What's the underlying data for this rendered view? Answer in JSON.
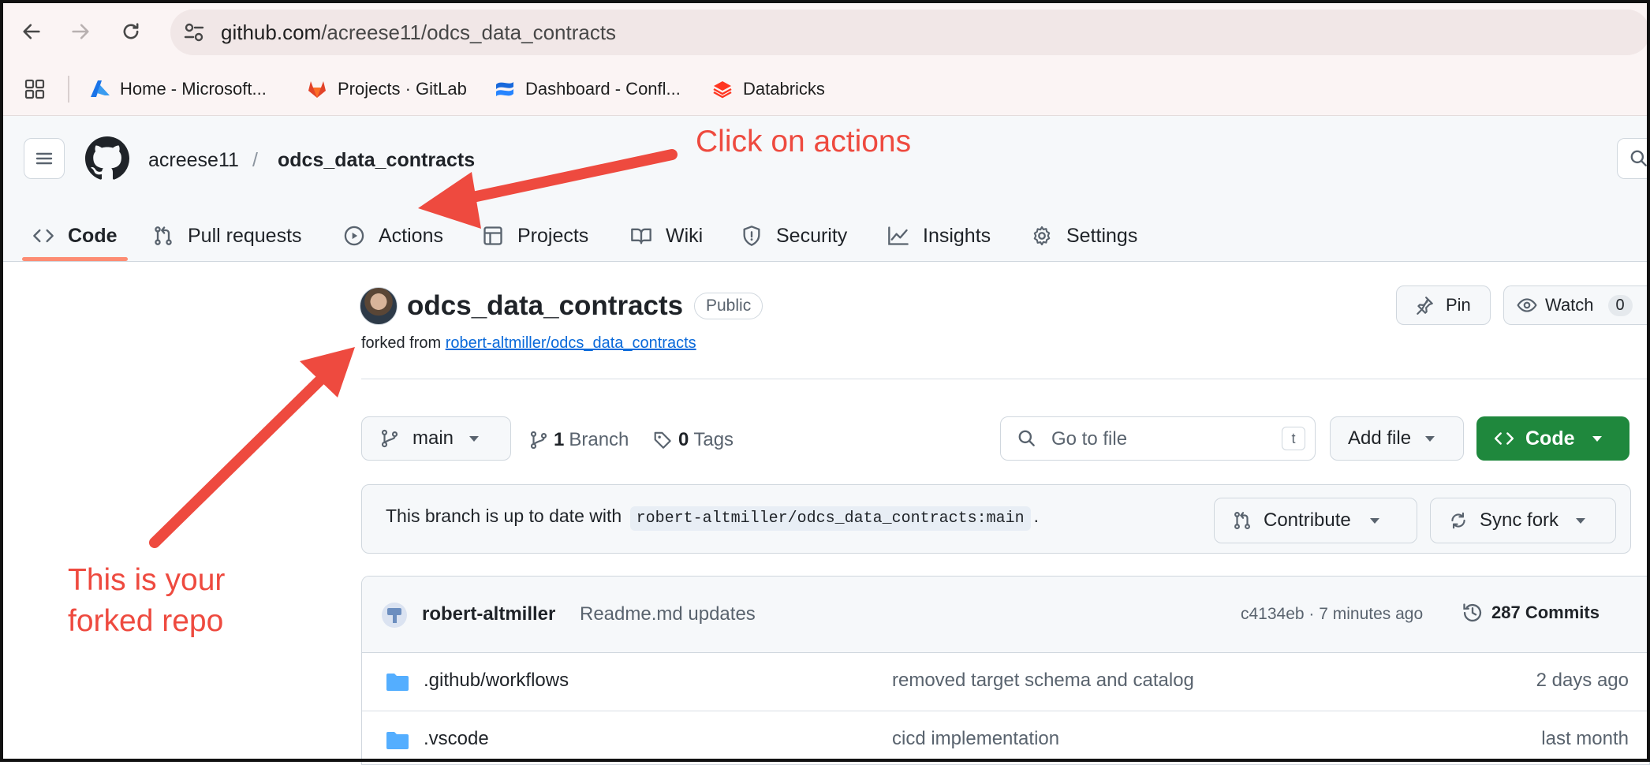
{
  "browser": {
    "url_host": "github.com",
    "url_path": "/acreese11/odcs_data_contracts",
    "bookmarks": [
      {
        "label": "Home - Microsoft...",
        "icon": "azure-icon"
      },
      {
        "label": "Projects · GitLab",
        "icon": "gitlab-icon"
      },
      {
        "label": "Dashboard - Confl...",
        "icon": "confluence-icon"
      },
      {
        "label": "Databricks",
        "icon": "databricks-icon"
      }
    ]
  },
  "header": {
    "owner": "acreese11",
    "separator": "/",
    "repo": "odcs_data_contracts"
  },
  "tabs": [
    {
      "label": "Code",
      "icon": "code-icon",
      "selected": true
    },
    {
      "label": "Pull requests",
      "icon": "pull-request-icon"
    },
    {
      "label": "Actions",
      "icon": "play-icon"
    },
    {
      "label": "Projects",
      "icon": "table-icon"
    },
    {
      "label": "Wiki",
      "icon": "book-icon"
    },
    {
      "label": "Security",
      "icon": "shield-icon"
    },
    {
      "label": "Insights",
      "icon": "graph-icon"
    },
    {
      "label": "Settings",
      "icon": "gear-icon"
    }
  ],
  "repo": {
    "name": "odcs_data_contracts",
    "visibility": "Public",
    "forked_prefix": "forked from",
    "forked_from": "robert-altmiller/odcs_data_contracts",
    "pin_label": "Pin",
    "watch_label": "Watch",
    "watch_count": "0"
  },
  "file_nav": {
    "branch": "main",
    "branch_count": "1",
    "branch_label": "Branch",
    "tag_count": "0",
    "tag_label": "Tags",
    "goto_placeholder": "Go to file",
    "goto_kbd": "t",
    "add_file_label": "Add file",
    "code_label": "Code"
  },
  "sync": {
    "text_before": "This branch is up to date with",
    "ref": "robert-altmiller/odcs_data_contracts:main",
    "text_after": ".",
    "contribute_label": "Contribute",
    "sync_label": "Sync fork"
  },
  "latest_commit": {
    "author": "robert-altmiller",
    "message": "Readme.md updates",
    "meta": "c4134eb · 7 minutes ago",
    "commits_label": "287 Commits"
  },
  "files": [
    {
      "name": ".github/workflows",
      "message": "removed target schema and catalog",
      "date": "2 days ago"
    },
    {
      "name": ".vscode",
      "message": "cicd implementation",
      "date": "last month"
    }
  ],
  "annotations": {
    "actions_note": "Click on actions",
    "fork_note_line1": "This is your",
    "fork_note_line2": "forked repo",
    "color": "#ee4a3f"
  },
  "colors": {
    "accent_green": "#1f883d",
    "link_blue": "#0969da",
    "tab_underline": "#fd8c73"
  }
}
